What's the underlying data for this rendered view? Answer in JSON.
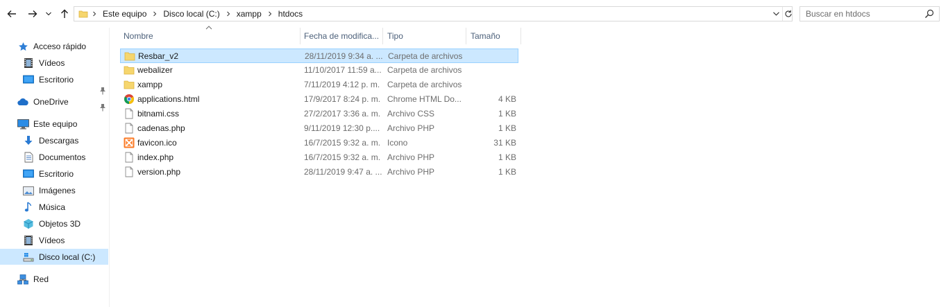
{
  "address_bar": {
    "crumbs": [
      "Este equipo",
      "Disco local (C:)",
      "xampp",
      "htdocs"
    ]
  },
  "search": {
    "placeholder": "Buscar en htdocs"
  },
  "nav_pane": {
    "items": [
      {
        "label": "Acceso rápido",
        "icon": "star-icon",
        "pinned": false
      },
      {
        "label": "Vídeos",
        "icon": "videos-icon",
        "pinned": true
      },
      {
        "label": "Escritorio",
        "icon": "desktop-icon",
        "pinned": true
      },
      {
        "label": "OneDrive",
        "icon": "cloud-icon",
        "pinned": false
      },
      {
        "label": "Este equipo",
        "icon": "computer-icon",
        "pinned": false
      },
      {
        "label": "Descargas",
        "icon": "downloads-icon",
        "pinned": false
      },
      {
        "label": "Documentos",
        "icon": "documents-icon",
        "pinned": false
      },
      {
        "label": "Escritorio",
        "icon": "desktop-icon",
        "pinned": false
      },
      {
        "label": "Imágenes",
        "icon": "pictures-icon",
        "pinned": false
      },
      {
        "label": "Música",
        "icon": "music-icon",
        "pinned": false
      },
      {
        "label": "Objetos 3D",
        "icon": "3d-objects-icon",
        "pinned": false
      },
      {
        "label": "Vídeos",
        "icon": "videos-icon",
        "pinned": false
      },
      {
        "label": "Disco local (C:)",
        "icon": "drive-icon",
        "pinned": false,
        "selected": true
      },
      {
        "label": "Red",
        "icon": "network-icon",
        "pinned": false
      }
    ]
  },
  "columns": {
    "name": "Nombre",
    "date": "Fecha de modifica...",
    "type": "Tipo",
    "size": "Tamaño"
  },
  "files": [
    {
      "name": "Resbar_v2",
      "date": "28/11/2019 9:34 a. ...",
      "type": "Carpeta de archivos",
      "size": "",
      "icon": "folder-icon",
      "selected": true
    },
    {
      "name": "webalizer",
      "date": "11/10/2017 11:59 a...",
      "type": "Carpeta de archivos",
      "size": "",
      "icon": "folder-icon"
    },
    {
      "name": "xampp",
      "date": "7/11/2019 4:12 p. m.",
      "type": "Carpeta de archivos",
      "size": "",
      "icon": "folder-icon"
    },
    {
      "name": "applications.html",
      "date": "17/9/2017 8:24 p. m.",
      "type": "Chrome HTML Do...",
      "size": "4 KB",
      "icon": "chrome-icon"
    },
    {
      "name": "bitnami.css",
      "date": "27/2/2017 3:36 a. m.",
      "type": "Archivo CSS",
      "size": "1 KB",
      "icon": "file-icon"
    },
    {
      "name": "cadenas.php",
      "date": "9/11/2019 12:30 p....",
      "type": "Archivo PHP",
      "size": "1 KB",
      "icon": "file-icon"
    },
    {
      "name": "favicon.ico",
      "date": "16/7/2015 9:32 a. m.",
      "type": "Icono",
      "size": "31 KB",
      "icon": "xampp-icon"
    },
    {
      "name": "index.php",
      "date": "16/7/2015 9:32 a. m.",
      "type": "Archivo PHP",
      "size": "1 KB",
      "icon": "file-icon"
    },
    {
      "name": "version.php",
      "date": "28/11/2019 9:47 a. ...",
      "type": "Archivo PHP",
      "size": "1 KB",
      "icon": "file-icon"
    }
  ]
}
